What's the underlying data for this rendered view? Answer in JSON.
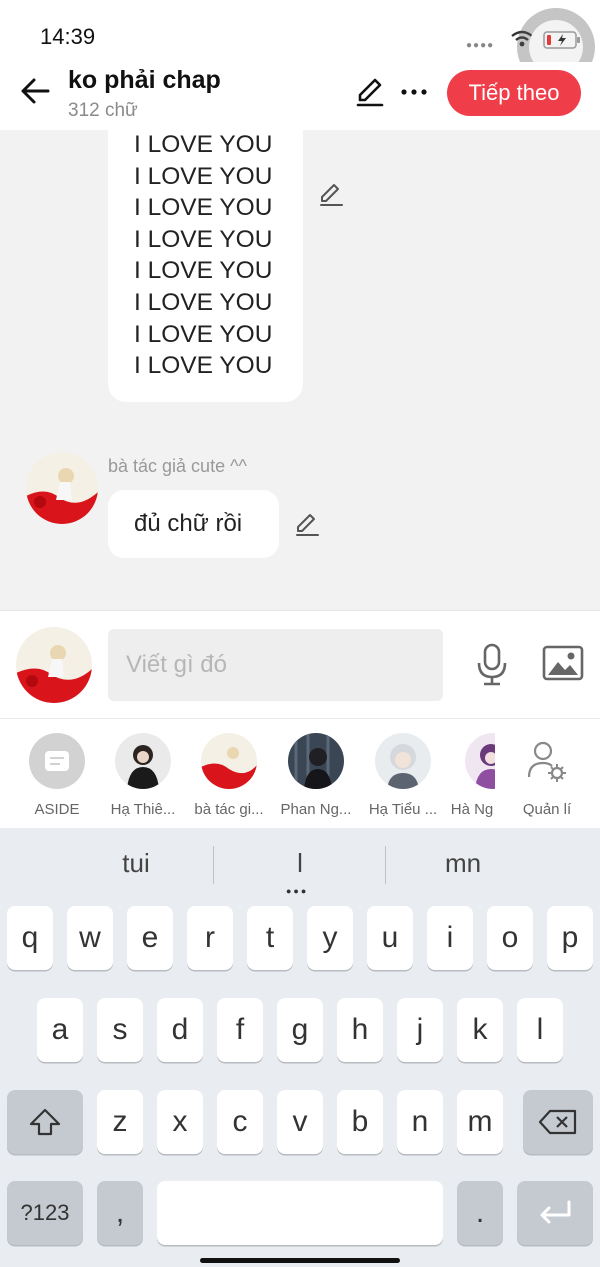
{
  "status": {
    "time": "14:39"
  },
  "header": {
    "title": "ko phải chap",
    "word_count": "312 chữ",
    "next_label": "Tiếp theo"
  },
  "chat": {
    "first_message_lines": [
      "I LOVE YOU",
      "I LOVE YOU",
      "I LOVE YOU",
      "I LOVE YOU",
      "I LOVE YOU",
      "I LOVE YOU",
      "I LOVE YOU",
      "I LOVE YOU"
    ],
    "sender": "bà tác giả cute ^^",
    "second_message": "đủ chữ rồi"
  },
  "composer": {
    "placeholder": "Viết gì đó"
  },
  "readers": [
    {
      "label": "ASIDE"
    },
    {
      "label": "Hạ Thiê..."
    },
    {
      "label": "bà tác gi..."
    },
    {
      "label": "Phan Ng..."
    },
    {
      "label": "Hạ Tiểu ..."
    },
    {
      "label": "Hà Ng"
    },
    {
      "label": "Quản lí"
    }
  ],
  "keyboard": {
    "suggestions": [
      "tui",
      "l",
      "mn"
    ],
    "row1": [
      "q",
      "w",
      "e",
      "r",
      "t",
      "y",
      "u",
      "i",
      "o",
      "p"
    ],
    "row2": [
      "a",
      "s",
      "d",
      "f",
      "g",
      "h",
      "j",
      "k",
      "l"
    ],
    "row3": [
      "z",
      "x",
      "c",
      "v",
      "b",
      "n",
      "m"
    ],
    "symbols_label": "?123",
    "comma": ",",
    "period": "."
  },
  "colors": {
    "accent": "#ef3e4a",
    "background": "#f2f2f2",
    "keyboard_bg": "#e9ecf0"
  }
}
